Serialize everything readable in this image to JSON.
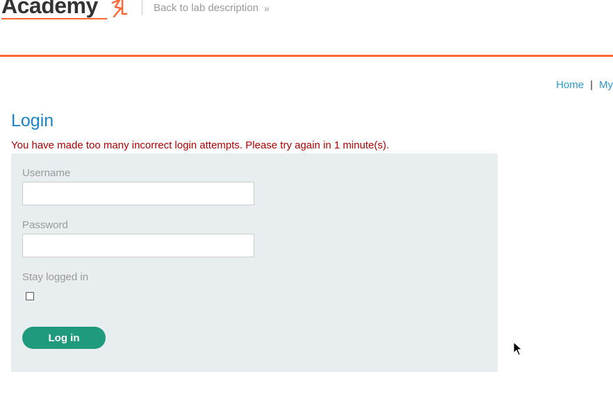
{
  "header": {
    "logo_text": "Academy",
    "back_link_label": "Back to lab description",
    "back_link_chevron": "»",
    "accent_color": "#ff6633"
  },
  "top_nav": {
    "items": [
      {
        "label": "Home"
      },
      {
        "label": "My"
      }
    ],
    "separator": "|"
  },
  "main": {
    "title": "Login",
    "error_message": "You have made too many incorrect login attempts. Please try again in 1 minute(s).",
    "form": {
      "username_label": "Username",
      "username_value": "",
      "password_label": "Password",
      "password_value": "",
      "stay_logged_in_label": "Stay logged in",
      "stay_logged_in_checked": false,
      "submit_label": "Log in"
    }
  },
  "colors": {
    "link": "#2b9ad6",
    "title": "#1a84c7",
    "error": "#b30000",
    "panel_bg": "#e8eef0",
    "button_bg": "#1f9a7d"
  },
  "icons": {
    "logo_mark": "academy-logo-mark-icon",
    "back_chevron": "double-chevron-right-icon",
    "cursor": "mouse-pointer-icon"
  }
}
